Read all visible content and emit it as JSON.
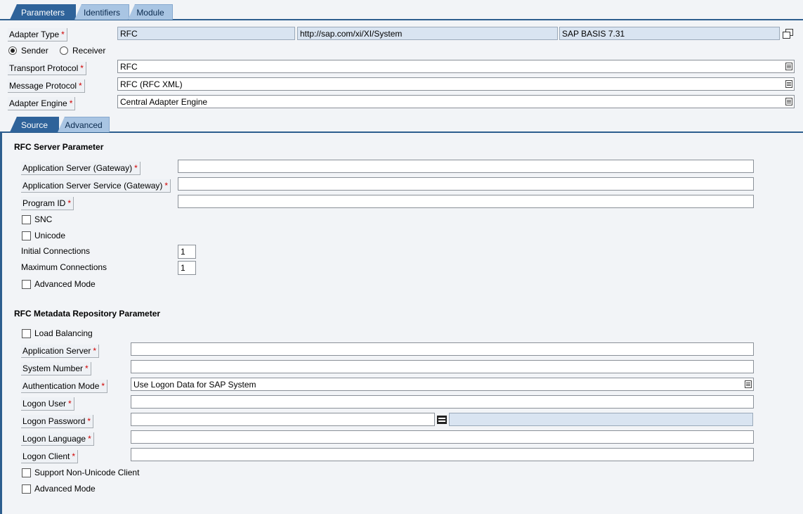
{
  "top_tabs": [
    "Parameters",
    "Identifiers",
    "Module"
  ],
  "adapter_type": {
    "label": "Adapter Type",
    "name": "RFC",
    "namespace": "http://sap.com/xi/XI/System",
    "swcv": "SAP BASIS 7.31"
  },
  "direction": {
    "sender": "Sender",
    "receiver": "Receiver",
    "selected": "Sender"
  },
  "transport_protocol": {
    "label": "Transport Protocol",
    "value": "RFC"
  },
  "message_protocol": {
    "label": "Message Protocol",
    "value": "RFC (RFC XML)"
  },
  "adapter_engine": {
    "label": "Adapter Engine",
    "value": "Central Adapter Engine"
  },
  "sub_tabs": [
    "Source",
    "Advanced"
  ],
  "rfc_server": {
    "title": "RFC Server Parameter",
    "app_server_label": "Application Server (Gateway)",
    "app_server_value": "",
    "app_service_label": "Application Server Service (Gateway)",
    "app_service_value": "",
    "program_id_label": "Program ID",
    "program_id_value": "",
    "snc_label": "SNC",
    "unicode_label": "Unicode",
    "initial_conn_label": "Initial Connections",
    "initial_conn_value": "1",
    "max_conn_label": "Maximum Connections",
    "max_conn_value": "1",
    "advanced_mode_label": "Advanced Mode"
  },
  "rfc_metadata": {
    "title": "RFC Metadata Repository Parameter",
    "load_balancing_label": "Load Balancing",
    "app_server_label": "Application Server",
    "app_server_value": "",
    "system_number_label": "System Number",
    "system_number_value": "",
    "auth_mode_label": "Authentication Mode",
    "auth_mode_value": "Use Logon Data for SAP System",
    "logon_user_label": "Logon User",
    "logon_user_value": "",
    "logon_password_label": "Logon Password",
    "logon_language_label": "Logon Language",
    "logon_client_label": "Logon Client",
    "non_unicode_label": "Support Non-Unicode Client",
    "advanced_mode_label": "Advanced Mode"
  },
  "required_mark": "*"
}
